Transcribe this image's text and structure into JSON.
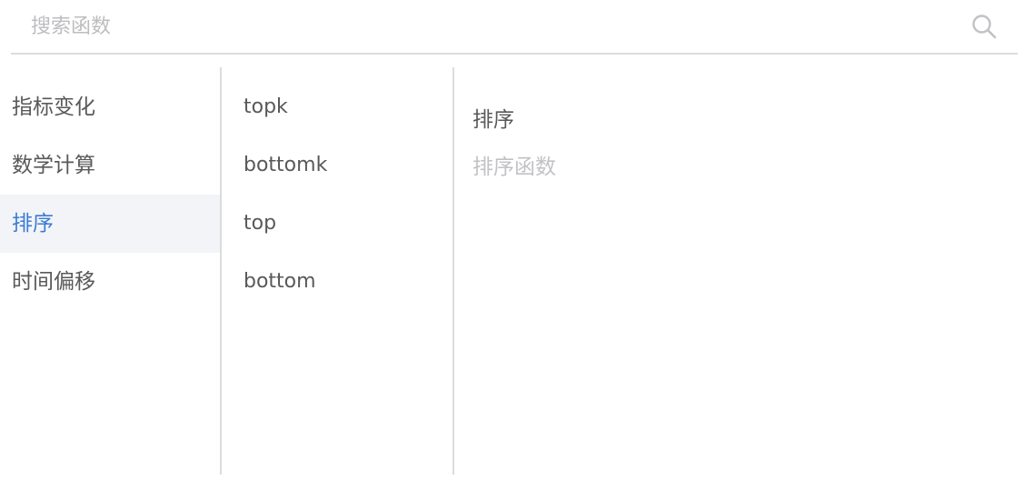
{
  "search": {
    "placeholder": "搜索函数",
    "value": ""
  },
  "categories": {
    "items": [
      {
        "label": "指标变化",
        "active": false
      },
      {
        "label": "数学计算",
        "active": false
      },
      {
        "label": "排序",
        "active": true
      },
      {
        "label": "时间偏移",
        "active": false
      }
    ]
  },
  "functions": {
    "items": [
      {
        "label": "topk"
      },
      {
        "label": "bottomk"
      },
      {
        "label": "top"
      },
      {
        "label": "bottom"
      }
    ]
  },
  "detail": {
    "title": "排序",
    "description": "排序函数"
  },
  "colors": {
    "accent": "#3a7bd5",
    "active_background": "#f3f4f7",
    "divider": "#dcdcde",
    "text": "#595959",
    "muted_text": "#c2c2c6"
  },
  "icons": {
    "search": "search-icon"
  }
}
